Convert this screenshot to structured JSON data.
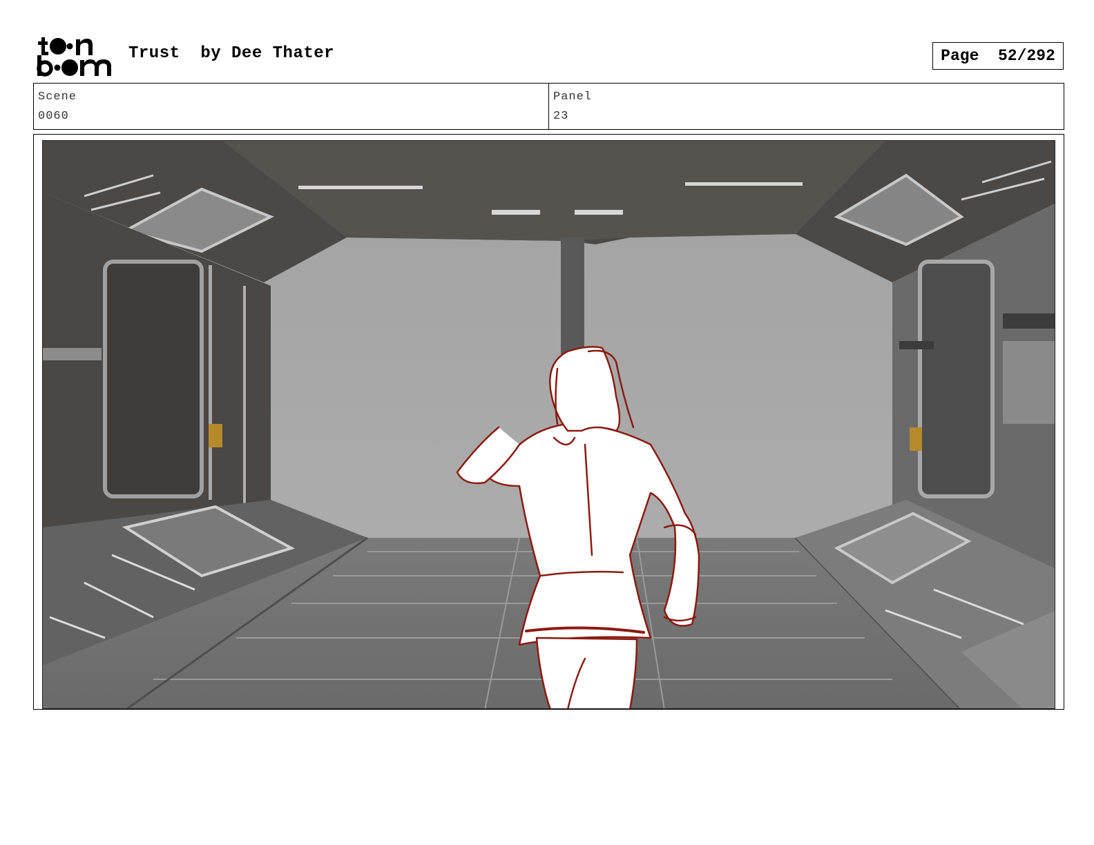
{
  "header": {
    "logo_text": "toon boom",
    "title": "Trust  by Dee Thater",
    "page_indicator": "Page  52/292"
  },
  "info": {
    "scene_label": "Scene",
    "scene_value": "0060",
    "panel_label": "Panel",
    "panel_value": "23"
  },
  "colors": {
    "sketch_line": "#8b1a10",
    "wall_dark": "#4a4744",
    "floor": "#6e6e6e",
    "backdrop": "#a9a9a9"
  },
  "icons": {
    "logo": "toon-boom-logo"
  }
}
